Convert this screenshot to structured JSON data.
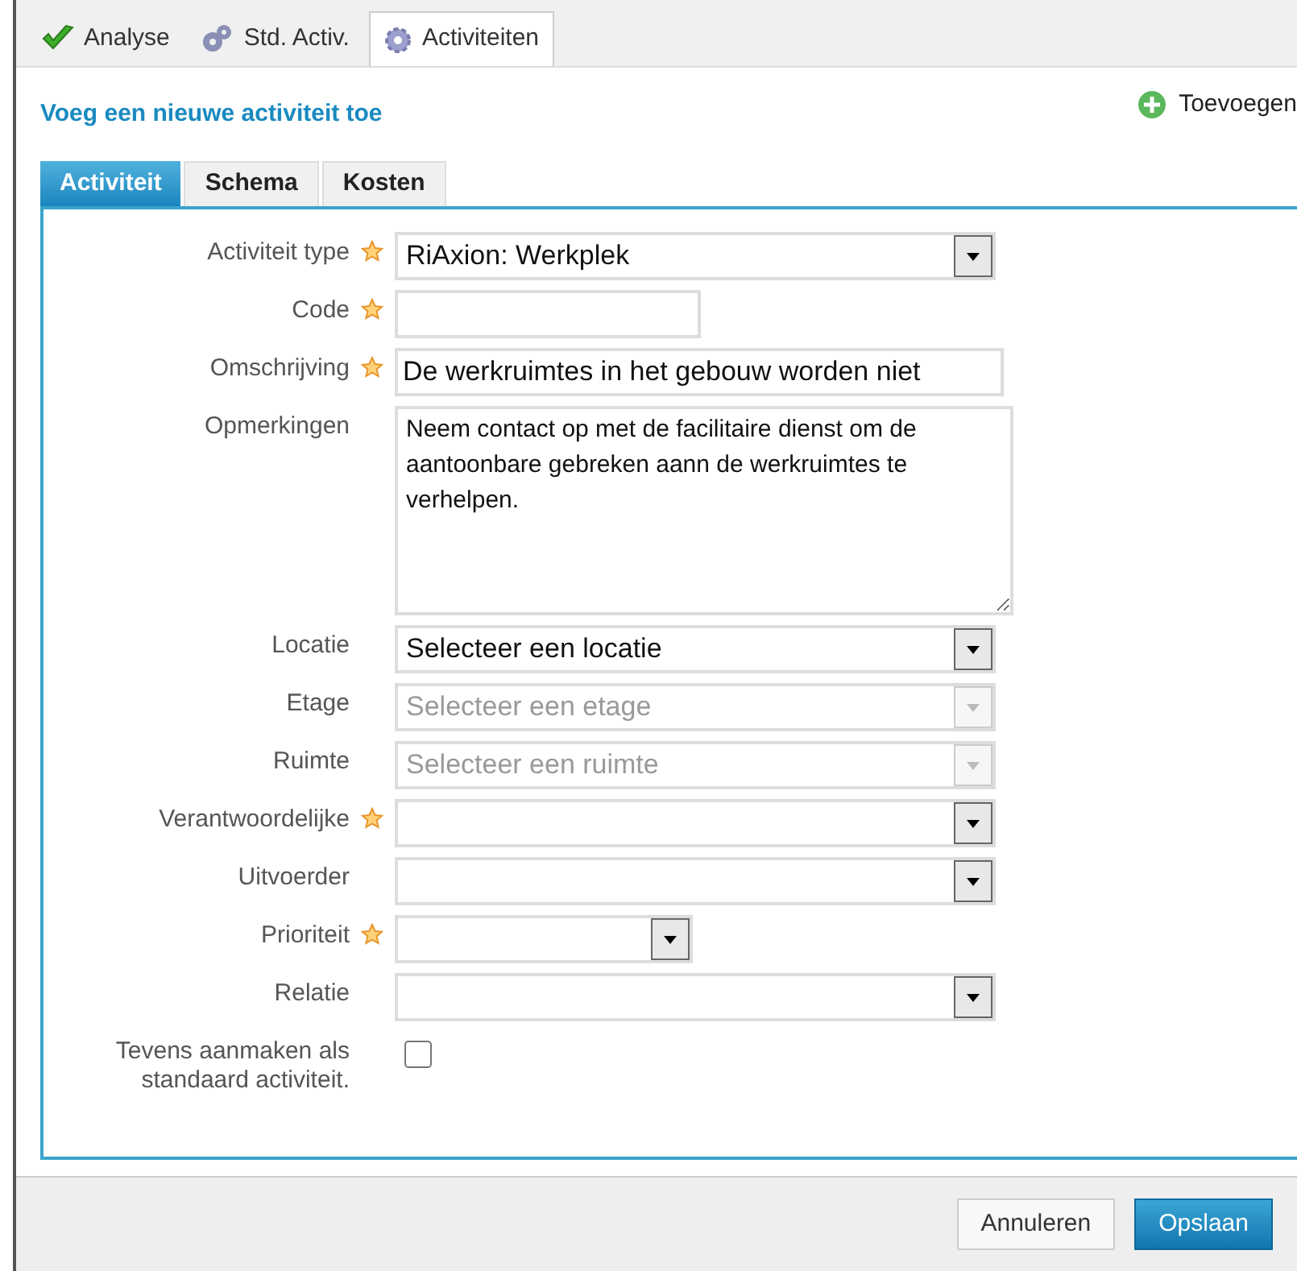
{
  "top_tabs": [
    {
      "label": "Analyse",
      "selected": false
    },
    {
      "label": "Std. Activ.",
      "selected": false
    },
    {
      "label": "Activiteiten",
      "selected": true
    }
  ],
  "heading": "Voeg een nieuwe activiteit toe",
  "add_link": "Toevoegen",
  "form_tabs": [
    {
      "label": "Activiteit",
      "selected": true
    },
    {
      "label": "Schema",
      "selected": false
    },
    {
      "label": "Kosten",
      "selected": false
    }
  ],
  "fields": [
    {
      "label": "Activiteit type",
      "required": true,
      "kind": "select",
      "value": "RiAxion: Werkplek",
      "disabled": false
    },
    {
      "label": "Code",
      "required": true,
      "kind": "text"
    },
    {
      "label": "Omschrijving",
      "required": true,
      "kind": "text",
      "value": "De werkruimtes in het gebouw worden niet"
    },
    {
      "label": "Opmerkingen",
      "required": false,
      "kind": "textarea",
      "value": "Neem contact op met de facilitaire dienst om de aantoonbare gebreken aann de werkruimtes te verhelpen."
    },
    {
      "label": "Locatie",
      "required": false,
      "kind": "select",
      "value": "Selecteer een locatie",
      "disabled": false
    },
    {
      "label": "Etage",
      "required": false,
      "kind": "select",
      "value": "Selecteer een etage",
      "disabled": true
    },
    {
      "label": "Ruimte",
      "required": false,
      "kind": "select",
      "value": "Selecteer een ruimte",
      "disabled": true
    },
    {
      "label": "Verantwoordelijke",
      "required": true,
      "kind": "select",
      "disabled": false
    },
    {
      "label": "Uitvoerder",
      "required": false,
      "kind": "select",
      "disabled": false
    },
    {
      "label": "Prioriteit",
      "required": true,
      "kind": "select",
      "disabled": false
    },
    {
      "label": "Relatie",
      "required": false,
      "kind": "select",
      "disabled": false
    },
    {
      "label": "Tevens aanmaken als standaard activiteit.",
      "required": false,
      "kind": "checkbox",
      "checked": false
    }
  ],
  "buttons": [
    {
      "label": "Annuleren",
      "kind": "secondary"
    },
    {
      "label": "Opslaan",
      "kind": "primary"
    }
  ]
}
